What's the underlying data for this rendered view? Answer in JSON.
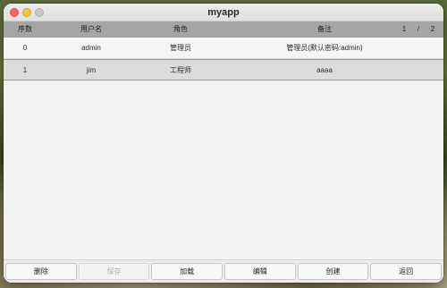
{
  "window": {
    "title": "myapp"
  },
  "table": {
    "columns": [
      "序数",
      "用户名",
      "角色",
      "备注"
    ],
    "rows": [
      {
        "index": "0",
        "username": "admin",
        "role": "管理员",
        "note": "管理员(默认密码:admin)"
      },
      {
        "index": "1",
        "username": "jim",
        "role": "工程师",
        "note": "aaaa"
      }
    ]
  },
  "pager": {
    "current": "1",
    "separator": "/",
    "total": "2"
  },
  "footer": {
    "delete_label": "删除",
    "save_label": "保存",
    "load_label": "加载",
    "edit_label": "编辑",
    "create_label": "创建",
    "back_label": "返回"
  },
  "colors": {
    "close": "#ed6a5e",
    "minimize": "#f5bf4f",
    "maximize_inactive": "#c6c6c6",
    "header_bg": "#a5a5a5",
    "selected_row_bg": "#dcdcdc"
  }
}
